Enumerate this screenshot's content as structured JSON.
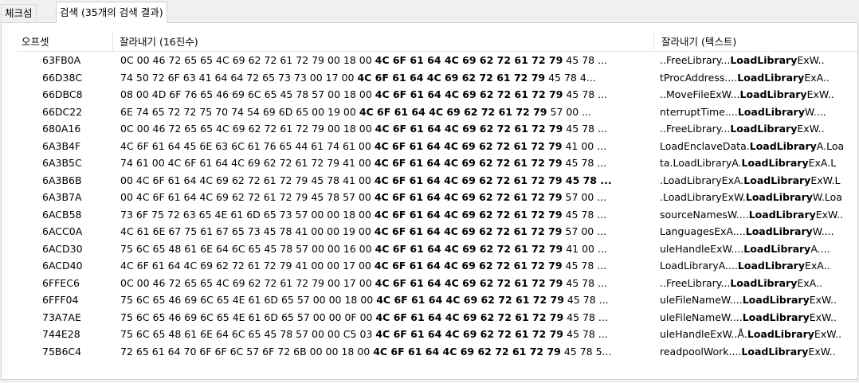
{
  "tabs": [
    {
      "label": "체크섬",
      "active": false
    },
    {
      "label": "검색 (35개의 검색 결과)",
      "active": true
    }
  ],
  "columns": {
    "offset": "오프셋",
    "hex": "잘라내기 (16진수)",
    "text": "잘라내기 (텍스트)"
  },
  "rows": [
    {
      "offset": "63FB0A",
      "hex_pre": "0C 00 46 72 65 65 4C 69 62 72 61 72 79 00 18 00 ",
      "hex_bold": "4C 6F 61 64 4C 69 62 72 61 72 79",
      "hex_post": " 45 78 ...",
      "txt_pre": "..FreeLibrary...",
      "txt_bold": "LoadLibrary",
      "txt_post": "ExW.."
    },
    {
      "offset": "66D38C",
      "hex_pre": "74 50 72 6F 63 41 64 64 72 65 73 73 00 17 00 ",
      "hex_bold": "4C 6F 61 64 4C 69 62 72 61 72 79",
      "hex_post": " 45 78 4...",
      "txt_pre": "tProcAddress....",
      "txt_bold": "LoadLibrary",
      "txt_post": "ExA.."
    },
    {
      "offset": "66DBC8",
      "hex_pre": "08 00 4D 6F 76 65 46 69 6C 65 45 78 57 00 18 00 ",
      "hex_bold": "4C 6F 61 64 4C 69 62 72 61 72 79",
      "hex_post": " 45 78 ...",
      "txt_pre": "..MoveFileExW...",
      "txt_bold": "LoadLibrary",
      "txt_post": "ExW.."
    },
    {
      "offset": "66DC22",
      "hex_pre": "6E 74 65 72 72 75 70 74 54 69 6D 65 00 19 00 ",
      "hex_bold": "4C 6F 61 64 4C 69 62 72 61 72 79",
      "hex_post": " 57 00 ...",
      "txt_pre": "nterruptTime....",
      "txt_bold": "LoadLibrary",
      "txt_post": "W...."
    },
    {
      "offset": "680A16",
      "hex_pre": "0C 00 46 72 65 65 4C 69 62 72 61 72 79 00 18 00 ",
      "hex_bold": "4C 6F 61 64 4C 69 62 72 61 72 79",
      "hex_post": " 45 78 ...",
      "txt_pre": "..FreeLibrary...",
      "txt_bold": "LoadLibrary",
      "txt_post": "ExW.."
    },
    {
      "offset": "6A3B4F",
      "hex_pre": "4C 6F 61 64 45 6E 63 6C 61 76 65 44 61 74 61 00 ",
      "hex_bold": "4C 6F 61 64 4C 69 62 72 61 72 79",
      "hex_post": " 41 00 ...",
      "txt_pre": "LoadEnclaveData.",
      "txt_bold": "LoadLibrary",
      "txt_post": "A.Loa"
    },
    {
      "offset": "6A3B5C",
      "hex_pre": "74 61 00 4C 6F 61 64 4C 69 62 72 61 72 79 41 00 ",
      "hex_bold": "4C 6F 61 64 4C 69 62 72 61 72 79",
      "hex_post": " 45 78 ...",
      "txt_pre": "ta.LoadLibraryA.",
      "txt_bold": "LoadLibrary",
      "txt_post": "ExA.L"
    },
    {
      "offset": "6A3B6B",
      "hex_pre": "00 4C 6F 61 64 4C 69 62 72 61 72 79 45 78 41 00 ",
      "hex_bold": "4C 6F 61 64 4C 69 62 72 61 72 79 45 78 ...",
      "hex_post": "",
      "txt_pre": ".LoadLibraryExA.",
      "txt_bold": "LoadLibrary",
      "txt_post": "ExW.L"
    },
    {
      "offset": "6A3B7A",
      "hex_pre": "00 4C 6F 61 64 4C 69 62 72 61 72 79 45 78 57 00 ",
      "hex_bold": "4C 6F 61 64 4C 69 62 72 61 72 79",
      "hex_post": " 57 00 ...",
      "txt_pre": ".LoadLibraryExW.",
      "txt_bold": "LoadLibrary",
      "txt_post": "W.Loa"
    },
    {
      "offset": "6ACB58",
      "hex_pre": "73 6F 75 72 63 65 4E 61 6D 65 73 57 00 00 18 00 ",
      "hex_bold": "4C 6F 61 64 4C 69 62 72 61 72 79",
      "hex_post": " 45 78 ...",
      "txt_pre": "sourceNamesW....",
      "txt_bold": "LoadLibrary",
      "txt_post": "ExW.."
    },
    {
      "offset": "6ACC0A",
      "hex_pre": "4C 61 6E 67 75 61 67 65 73 45 78 41 00 00 19 00 ",
      "hex_bold": "4C 6F 61 64 4C 69 62 72 61 72 79",
      "hex_post": " 57 00 ...",
      "txt_pre": "LanguagesExA....",
      "txt_bold": "LoadLibrary",
      "txt_post": "W...."
    },
    {
      "offset": "6ACD30",
      "hex_pre": "75 6C 65 48 61 6E 64 6C 65 45 78 57 00 00 16 00 ",
      "hex_bold": "4C 6F 61 64 4C 69 62 72 61 72 79",
      "hex_post": " 41 00 ...",
      "txt_pre": "uleHandleExW....",
      "txt_bold": "LoadLibrary",
      "txt_post": "A...."
    },
    {
      "offset": "6ACD40",
      "hex_pre": "4C 6F 61 64 4C 69 62 72 61 72 79 41 00 00 17 00 ",
      "hex_bold": "4C 6F 61 64 4C 69 62 72 61 72 79",
      "hex_post": " 45 78 ...",
      "txt_pre": "LoadLibraryA....",
      "txt_bold": "LoadLibrary",
      "txt_post": "ExA.."
    },
    {
      "offset": "6FFEC6",
      "hex_pre": "0C 00 46 72 65 65 4C 69 62 72 61 72 79 00 17 00 ",
      "hex_bold": "4C 6F 61 64 4C 69 62 72 61 72 79",
      "hex_post": " 45 78 ...",
      "txt_pre": "..FreeLibrary...",
      "txt_bold": "LoadLibrary",
      "txt_post": "ExA.."
    },
    {
      "offset": "6FFF04",
      "hex_pre": "75 6C 65 46 69 6C 65 4E 61 6D 65 57 00 00 18 00 ",
      "hex_bold": "4C 6F 61 64 4C 69 62 72 61 72 79",
      "hex_post": " 45 78 ...",
      "txt_pre": "uleFileNameW....",
      "txt_bold": "LoadLibrary",
      "txt_post": "ExW.."
    },
    {
      "offset": "73A7AE",
      "hex_pre": "75 6C 65 46 69 6C 65 4E 61 6D 65 57 00 00 0F 00 ",
      "hex_bold": "4C 6F 61 64 4C 69 62 72 61 72 79",
      "hex_post": " 45 78 ...",
      "txt_pre": "uleFileNameW....",
      "txt_bold": "LoadLibrary",
      "txt_post": "ExW.."
    },
    {
      "offset": "744E28",
      "hex_pre": "75 6C 65 48 61 6E 64 6C 65 45 78 57 00 00 C5 03 ",
      "hex_bold": "4C 6F 61 64 4C 69 62 72 61 72 79",
      "hex_post": " 45 78 ...",
      "txt_pre": "uleHandleExW..Å.",
      "txt_bold": "LoadLibrary",
      "txt_post": "ExW.."
    },
    {
      "offset": "75B6C4",
      "hex_pre": "72 65 61 64 70 6F 6F 6C 57 6F 72 6B 00 00 18 00 ",
      "hex_bold": "4C 6F 61 64 4C 69 62 72 61 72 79",
      "hex_post": " 45 78 5...",
      "txt_pre": "readpoolWork....",
      "txt_bold": "LoadLibrary",
      "txt_post": "ExW.."
    }
  ]
}
